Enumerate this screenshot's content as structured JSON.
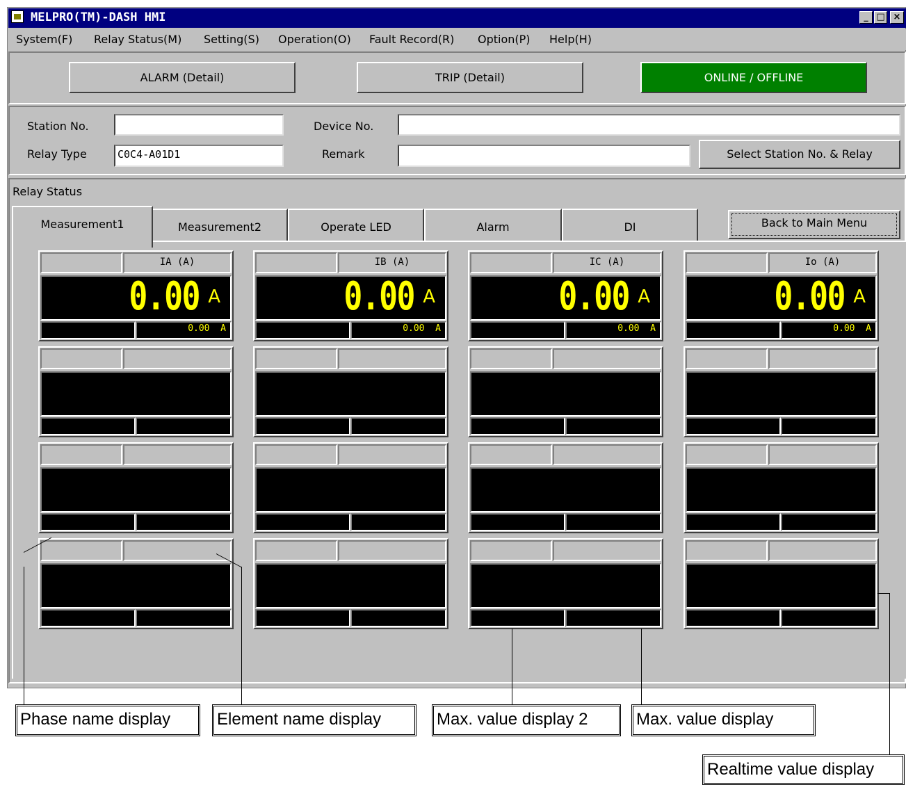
{
  "window": {
    "title": "MELPRO(TM)-DASH HMI",
    "min": "_",
    "max": "□",
    "close": "×"
  },
  "menu": [
    "System(F)",
    "Relay Status(M)",
    "Setting(S)",
    "Operation(O)",
    "Fault Record(R)",
    "Option(P)",
    "Help(H)"
  ],
  "top_buttons": {
    "alarm": "ALARM (Detail)",
    "trip": "TRIP (Detail)",
    "online": "ONLINE / OFFLINE"
  },
  "colors": {
    "online_bg": "#008000",
    "display_bg": "#000000",
    "display_fg": "#ffff00",
    "title_bg": "#000080"
  },
  "station": {
    "station_no_label": "Station No.",
    "station_no_value": "",
    "device_no_label": "Device No.",
    "device_no_value": "",
    "relay_type_label": "Relay Type",
    "relay_type_value": "C0C4-A01D1",
    "remark_label": "Remark",
    "remark_value": "",
    "select_button": "Select Station No. & Relay"
  },
  "relay_status": {
    "label": "Relay Status",
    "tabs": [
      "Measurement1",
      "Measurement2",
      "Operate LED",
      "Alarm",
      "DI"
    ],
    "active_tab": "Measurement1",
    "back_button": "Back to Main Menu"
  },
  "meters": [
    {
      "element": "IA (A)",
      "value": "0.00",
      "unit": "A",
      "max": "0.00  A"
    },
    {
      "element": "IB (A)",
      "value": "0.00",
      "unit": "A",
      "max": "0.00  A"
    },
    {
      "element": "IC (A)",
      "value": "0.00",
      "unit": "A",
      "max": "0.00  A"
    },
    {
      "element": "Io (A)",
      "value": "0.00",
      "unit": "A",
      "max": "0.00  A"
    }
  ],
  "callouts": {
    "phase": "Phase name display",
    "element": "Element name display",
    "max2": "Max. value display 2",
    "max": "Max. value display",
    "realtime": "Realtime value display"
  }
}
